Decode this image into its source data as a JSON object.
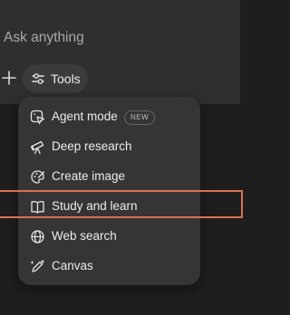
{
  "composer": {
    "placeholder": "Ask anything"
  },
  "toolbar": {
    "plus_icon": "plus-icon",
    "tools_icon": "sliders-icon",
    "tools_label": "Tools"
  },
  "menu": {
    "items": [
      {
        "label": "Agent mode",
        "icon": "agent-cursor-icon",
        "badge": "NEW"
      },
      {
        "label": "Deep research",
        "icon": "telescope-icon"
      },
      {
        "label": "Create image",
        "icon": "palette-icon"
      },
      {
        "label": "Study and learn",
        "icon": "book-icon",
        "highlighted": true
      },
      {
        "label": "Web search",
        "icon": "globe-icon"
      },
      {
        "label": "Canvas",
        "icon": "pen-sparkle-icon"
      }
    ]
  },
  "colors": {
    "background": "#1e1e1e",
    "composer": "#2f2f2f",
    "menu": "#353535",
    "highlight": "#d8744c",
    "text": "#ececec",
    "placeholder": "#a9a9a9"
  }
}
